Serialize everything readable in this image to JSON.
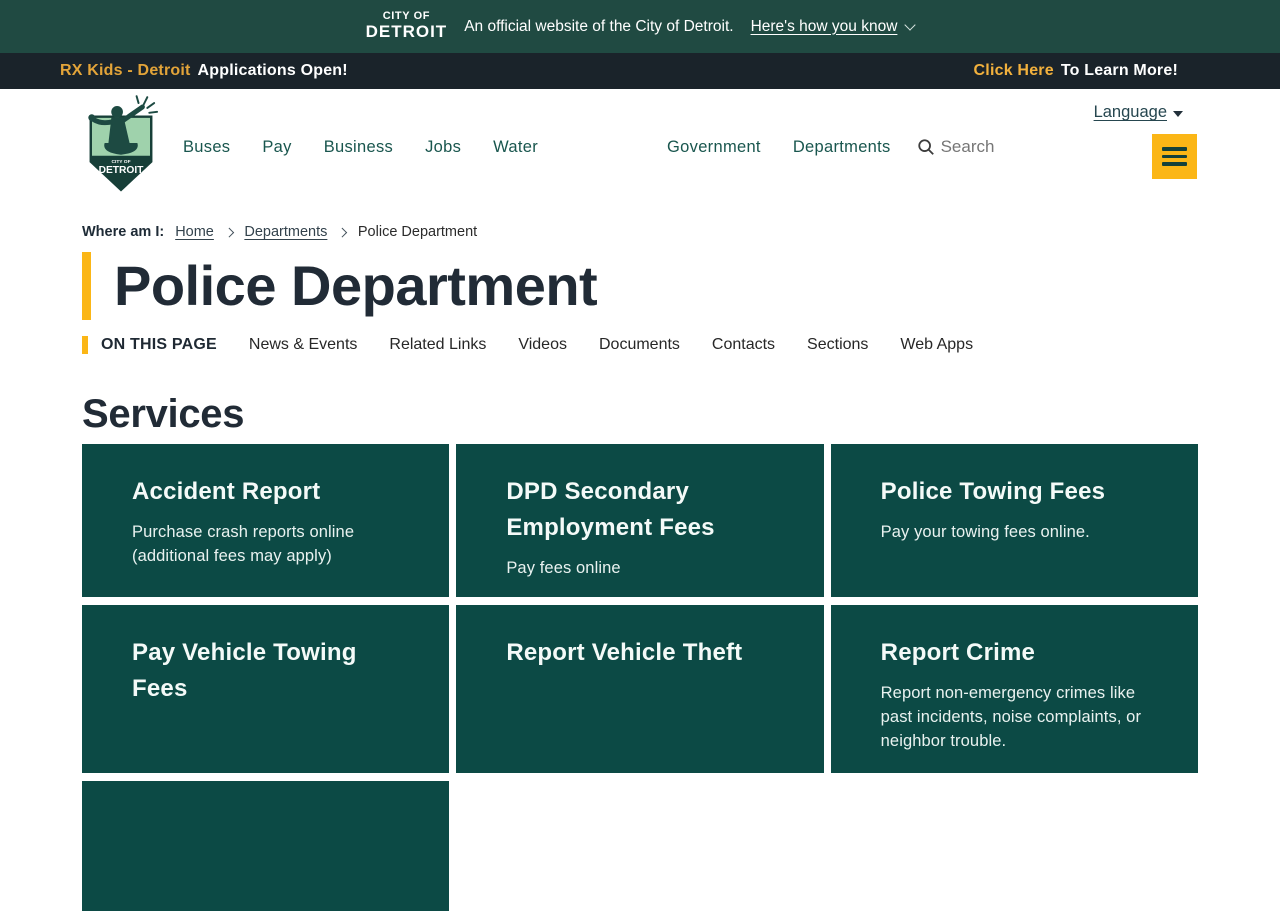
{
  "colors": {
    "topbar_bg": "#204a42",
    "banner_bg": "#1a232a",
    "accent_amber": "#fbb616",
    "banner_orange_link": "#e3a439",
    "banner_yellow_link": "#f2b13d",
    "nav_teal": "#19564e",
    "card_teal": "#0c4a45",
    "heading_dark": "#212b36"
  },
  "topbar": {
    "logo_line1": "CITY OF",
    "logo_line2": "DETROIT",
    "official_text": "An official website of the City of Detroit.",
    "how_link": "Here's how you know"
  },
  "banner": {
    "left_link": "RX Kids - Detroit",
    "left_text": "Applications Open!",
    "right_link": "Click Here",
    "right_text": "To Learn More!"
  },
  "header": {
    "logo_caption_small": "CITY OF",
    "logo_caption_large": "DETROIT",
    "nav_left": [
      "Buses",
      "Pay",
      "Business",
      "Jobs",
      "Water"
    ],
    "nav_right": [
      "Government",
      "Departments"
    ],
    "search_label": "Search",
    "language_label": "Language"
  },
  "breadcrumb": {
    "prefix": "Where am I:",
    "link1": "Home",
    "link2": "Departments",
    "current": "Police Department"
  },
  "page": {
    "title": "Police Department",
    "on_this_page_label": "ON THIS PAGE",
    "tabs": [
      "News & Events",
      "Related Links",
      "Videos",
      "Documents",
      "Contacts",
      "Sections",
      "Web Apps"
    ],
    "services_heading": "Services"
  },
  "services": {
    "cards": [
      {
        "title": "Accident Report",
        "description": "Purchase crash reports online (additional fees may apply)"
      },
      {
        "title": "DPD Secondary Employment Fees",
        "description": "Pay fees online"
      },
      {
        "title": "Police Towing Fees",
        "description": "Pay your towing fees online."
      },
      {
        "title": "Pay Vehicle Towing Fees",
        "description": ""
      },
      {
        "title": "Report Vehicle Theft",
        "description": ""
      },
      {
        "title": "Report Crime",
        "description": "Report non-emergency crimes like past incidents, noise complaints, or neighbor trouble."
      },
      {
        "title": "",
        "description": ""
      }
    ]
  }
}
